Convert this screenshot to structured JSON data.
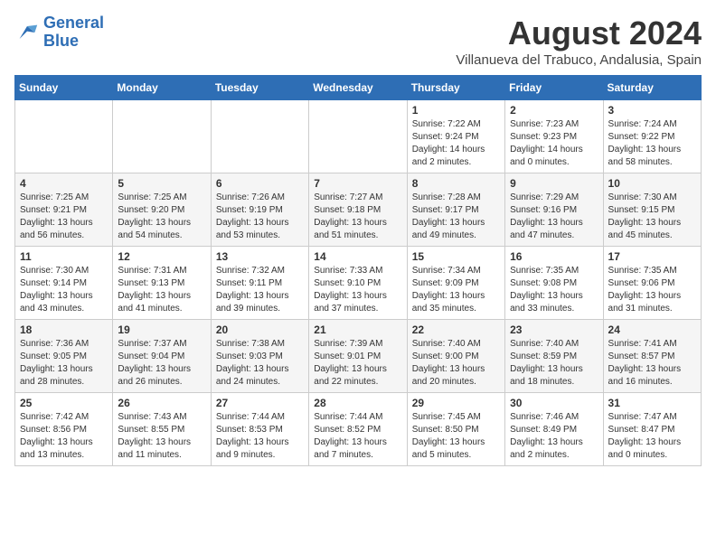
{
  "header": {
    "logo_text_general": "General",
    "logo_text_blue": "Blue",
    "month_year": "August 2024",
    "subtitle": "Villanueva del Trabuco, Andalusia, Spain"
  },
  "calendar": {
    "days_of_week": [
      "Sunday",
      "Monday",
      "Tuesday",
      "Wednesday",
      "Thursday",
      "Friday",
      "Saturday"
    ],
    "weeks": [
      [
        {
          "day": "",
          "info": ""
        },
        {
          "day": "",
          "info": ""
        },
        {
          "day": "",
          "info": ""
        },
        {
          "day": "",
          "info": ""
        },
        {
          "day": "1",
          "info": "Sunrise: 7:22 AM\nSunset: 9:24 PM\nDaylight: 14 hours\nand 2 minutes."
        },
        {
          "day": "2",
          "info": "Sunrise: 7:23 AM\nSunset: 9:23 PM\nDaylight: 14 hours\nand 0 minutes."
        },
        {
          "day": "3",
          "info": "Sunrise: 7:24 AM\nSunset: 9:22 PM\nDaylight: 13 hours\nand 58 minutes."
        }
      ],
      [
        {
          "day": "4",
          "info": "Sunrise: 7:25 AM\nSunset: 9:21 PM\nDaylight: 13 hours\nand 56 minutes."
        },
        {
          "day": "5",
          "info": "Sunrise: 7:25 AM\nSunset: 9:20 PM\nDaylight: 13 hours\nand 54 minutes."
        },
        {
          "day": "6",
          "info": "Sunrise: 7:26 AM\nSunset: 9:19 PM\nDaylight: 13 hours\nand 53 minutes."
        },
        {
          "day": "7",
          "info": "Sunrise: 7:27 AM\nSunset: 9:18 PM\nDaylight: 13 hours\nand 51 minutes."
        },
        {
          "day": "8",
          "info": "Sunrise: 7:28 AM\nSunset: 9:17 PM\nDaylight: 13 hours\nand 49 minutes."
        },
        {
          "day": "9",
          "info": "Sunrise: 7:29 AM\nSunset: 9:16 PM\nDaylight: 13 hours\nand 47 minutes."
        },
        {
          "day": "10",
          "info": "Sunrise: 7:30 AM\nSunset: 9:15 PM\nDaylight: 13 hours\nand 45 minutes."
        }
      ],
      [
        {
          "day": "11",
          "info": "Sunrise: 7:30 AM\nSunset: 9:14 PM\nDaylight: 13 hours\nand 43 minutes."
        },
        {
          "day": "12",
          "info": "Sunrise: 7:31 AM\nSunset: 9:13 PM\nDaylight: 13 hours\nand 41 minutes."
        },
        {
          "day": "13",
          "info": "Sunrise: 7:32 AM\nSunset: 9:11 PM\nDaylight: 13 hours\nand 39 minutes."
        },
        {
          "day": "14",
          "info": "Sunrise: 7:33 AM\nSunset: 9:10 PM\nDaylight: 13 hours\nand 37 minutes."
        },
        {
          "day": "15",
          "info": "Sunrise: 7:34 AM\nSunset: 9:09 PM\nDaylight: 13 hours\nand 35 minutes."
        },
        {
          "day": "16",
          "info": "Sunrise: 7:35 AM\nSunset: 9:08 PM\nDaylight: 13 hours\nand 33 minutes."
        },
        {
          "day": "17",
          "info": "Sunrise: 7:35 AM\nSunset: 9:06 PM\nDaylight: 13 hours\nand 31 minutes."
        }
      ],
      [
        {
          "day": "18",
          "info": "Sunrise: 7:36 AM\nSunset: 9:05 PM\nDaylight: 13 hours\nand 28 minutes."
        },
        {
          "day": "19",
          "info": "Sunrise: 7:37 AM\nSunset: 9:04 PM\nDaylight: 13 hours\nand 26 minutes."
        },
        {
          "day": "20",
          "info": "Sunrise: 7:38 AM\nSunset: 9:03 PM\nDaylight: 13 hours\nand 24 minutes."
        },
        {
          "day": "21",
          "info": "Sunrise: 7:39 AM\nSunset: 9:01 PM\nDaylight: 13 hours\nand 22 minutes."
        },
        {
          "day": "22",
          "info": "Sunrise: 7:40 AM\nSunset: 9:00 PM\nDaylight: 13 hours\nand 20 minutes."
        },
        {
          "day": "23",
          "info": "Sunrise: 7:40 AM\nSunset: 8:59 PM\nDaylight: 13 hours\nand 18 minutes."
        },
        {
          "day": "24",
          "info": "Sunrise: 7:41 AM\nSunset: 8:57 PM\nDaylight: 13 hours\nand 16 minutes."
        }
      ],
      [
        {
          "day": "25",
          "info": "Sunrise: 7:42 AM\nSunset: 8:56 PM\nDaylight: 13 hours\nand 13 minutes."
        },
        {
          "day": "26",
          "info": "Sunrise: 7:43 AM\nSunset: 8:55 PM\nDaylight: 13 hours\nand 11 minutes."
        },
        {
          "day": "27",
          "info": "Sunrise: 7:44 AM\nSunset: 8:53 PM\nDaylight: 13 hours\nand 9 minutes."
        },
        {
          "day": "28",
          "info": "Sunrise: 7:44 AM\nSunset: 8:52 PM\nDaylight: 13 hours\nand 7 minutes."
        },
        {
          "day": "29",
          "info": "Sunrise: 7:45 AM\nSunset: 8:50 PM\nDaylight: 13 hours\nand 5 minutes."
        },
        {
          "day": "30",
          "info": "Sunrise: 7:46 AM\nSunset: 8:49 PM\nDaylight: 13 hours\nand 2 minutes."
        },
        {
          "day": "31",
          "info": "Sunrise: 7:47 AM\nSunset: 8:47 PM\nDaylight: 13 hours\nand 0 minutes."
        }
      ]
    ]
  }
}
